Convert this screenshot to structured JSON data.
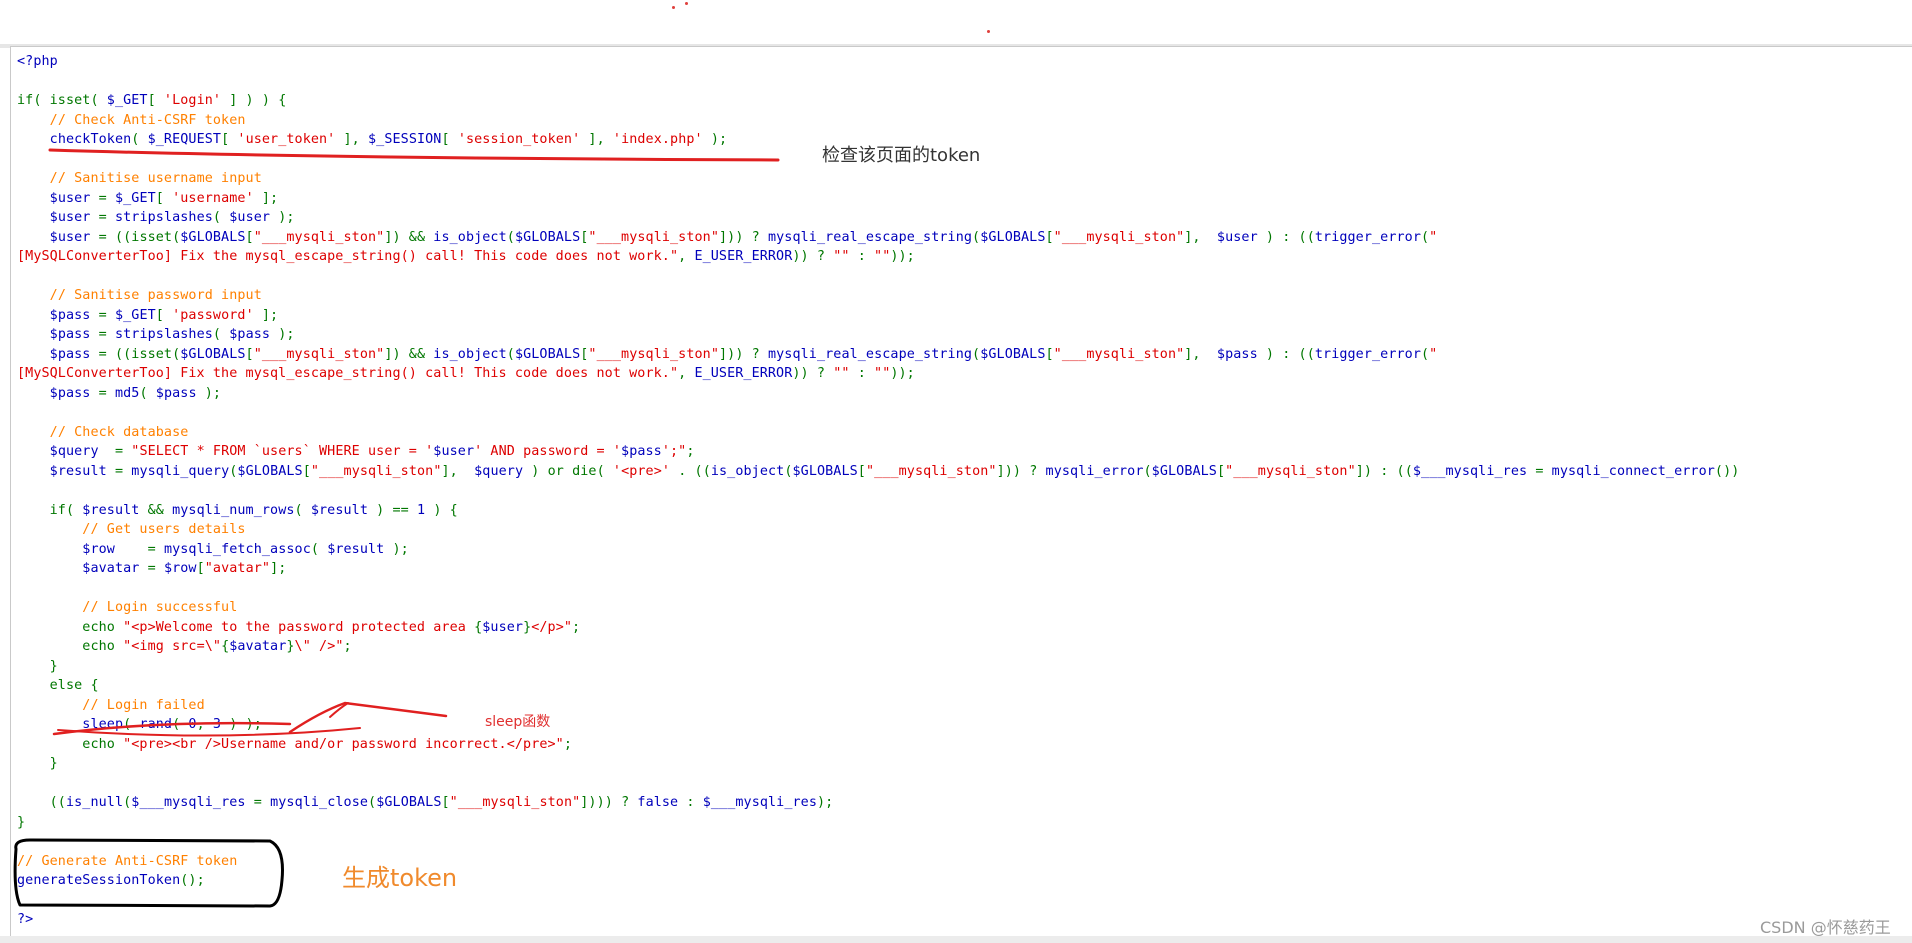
{
  "code": {
    "lines": [
      [
        [
          "php",
          "<?php"
        ]
      ],
      [],
      [
        [
          "kw",
          "if( isset( "
        ],
        [
          "php",
          "$_GET"
        ],
        [
          "kw",
          "[ "
        ],
        [
          "str",
          "'Login'"
        ],
        [
          "kw",
          " ] ) ) {"
        ]
      ],
      [
        [
          "kw",
          "    "
        ],
        [
          "cmt",
          "// Check Anti-CSRF token"
        ]
      ],
      [
        [
          "kw",
          "    "
        ],
        [
          "php",
          "checkToken"
        ],
        [
          "kw",
          "( "
        ],
        [
          "php",
          "$_REQUEST"
        ],
        [
          "kw",
          "[ "
        ],
        [
          "str",
          "'user_token'"
        ],
        [
          "kw",
          " ], "
        ],
        [
          "php",
          "$_SESSION"
        ],
        [
          "kw",
          "[ "
        ],
        [
          "str",
          "'session_token'"
        ],
        [
          "kw",
          " ], "
        ],
        [
          "str",
          "'index.php'"
        ],
        [
          "kw",
          " );"
        ]
      ],
      [],
      [
        [
          "kw",
          "    "
        ],
        [
          "cmt",
          "// Sanitise username input"
        ]
      ],
      [
        [
          "kw",
          "    "
        ],
        [
          "php",
          "$user"
        ],
        [
          "kw",
          " = "
        ],
        [
          "php",
          "$_GET"
        ],
        [
          "kw",
          "[ "
        ],
        [
          "str",
          "'username'"
        ],
        [
          "kw",
          " ];"
        ]
      ],
      [
        [
          "kw",
          "    "
        ],
        [
          "php",
          "$user"
        ],
        [
          "kw",
          " = "
        ],
        [
          "php",
          "stripslashes"
        ],
        [
          "kw",
          "( "
        ],
        [
          "php",
          "$user"
        ],
        [
          "kw",
          " );"
        ]
      ],
      [
        [
          "kw",
          "    "
        ],
        [
          "php",
          "$user"
        ],
        [
          "kw",
          " = ((isset("
        ],
        [
          "php",
          "$GLOBALS"
        ],
        [
          "kw",
          "["
        ],
        [
          "str",
          "\"___mysqli_ston\""
        ],
        [
          "kw",
          "]) && "
        ],
        [
          "php",
          "is_object"
        ],
        [
          "kw",
          "("
        ],
        [
          "php",
          "$GLOBALS"
        ],
        [
          "kw",
          "["
        ],
        [
          "str",
          "\"___mysqli_ston\""
        ],
        [
          "kw",
          "])) ? "
        ],
        [
          "php",
          "mysqli_real_escape_string"
        ],
        [
          "kw",
          "("
        ],
        [
          "php",
          "$GLOBALS"
        ],
        [
          "kw",
          "["
        ],
        [
          "str",
          "\"___mysqli_ston\""
        ],
        [
          "kw",
          "],  "
        ],
        [
          "php",
          "$user"
        ],
        [
          "kw",
          " ) : (("
        ],
        [
          "php",
          "trigger_error"
        ],
        [
          "kw",
          "("
        ],
        [
          "str",
          "\""
        ]
      ],
      [
        [
          "str",
          "[MySQLConverterToo] Fix the mysql_escape_string() call! This code does not work.\""
        ],
        [
          "kw",
          ", "
        ],
        [
          "php",
          "E_USER_ERROR"
        ],
        [
          "kw",
          ")) ? "
        ],
        [
          "str",
          "\"\""
        ],
        [
          "kw",
          " : "
        ],
        [
          "str",
          "\"\""
        ],
        [
          "kw",
          "));"
        ]
      ],
      [],
      [
        [
          "kw",
          "    "
        ],
        [
          "cmt",
          "// Sanitise password input"
        ]
      ],
      [
        [
          "kw",
          "    "
        ],
        [
          "php",
          "$pass"
        ],
        [
          "kw",
          " = "
        ],
        [
          "php",
          "$_GET"
        ],
        [
          "kw",
          "[ "
        ],
        [
          "str",
          "'password'"
        ],
        [
          "kw",
          " ];"
        ]
      ],
      [
        [
          "kw",
          "    "
        ],
        [
          "php",
          "$pass"
        ],
        [
          "kw",
          " = "
        ],
        [
          "php",
          "stripslashes"
        ],
        [
          "kw",
          "( "
        ],
        [
          "php",
          "$pass"
        ],
        [
          "kw",
          " );"
        ]
      ],
      [
        [
          "kw",
          "    "
        ],
        [
          "php",
          "$pass"
        ],
        [
          "kw",
          " = ((isset("
        ],
        [
          "php",
          "$GLOBALS"
        ],
        [
          "kw",
          "["
        ],
        [
          "str",
          "\"___mysqli_ston\""
        ],
        [
          "kw",
          "]) && "
        ],
        [
          "php",
          "is_object"
        ],
        [
          "kw",
          "("
        ],
        [
          "php",
          "$GLOBALS"
        ],
        [
          "kw",
          "["
        ],
        [
          "str",
          "\"___mysqli_ston\""
        ],
        [
          "kw",
          "])) ? "
        ],
        [
          "php",
          "mysqli_real_escape_string"
        ],
        [
          "kw",
          "("
        ],
        [
          "php",
          "$GLOBALS"
        ],
        [
          "kw",
          "["
        ],
        [
          "str",
          "\"___mysqli_ston\""
        ],
        [
          "kw",
          "],  "
        ],
        [
          "php",
          "$pass"
        ],
        [
          "kw",
          " ) : (("
        ],
        [
          "php",
          "trigger_error"
        ],
        [
          "kw",
          "("
        ],
        [
          "str",
          "\""
        ]
      ],
      [
        [
          "str",
          "[MySQLConverterToo] Fix the mysql_escape_string() call! This code does not work.\""
        ],
        [
          "kw",
          ", "
        ],
        [
          "php",
          "E_USER_ERROR"
        ],
        [
          "kw",
          ")) ? "
        ],
        [
          "str",
          "\"\""
        ],
        [
          "kw",
          " : "
        ],
        [
          "str",
          "\"\""
        ],
        [
          "kw",
          "));"
        ]
      ],
      [
        [
          "kw",
          "    "
        ],
        [
          "php",
          "$pass"
        ],
        [
          "kw",
          " = "
        ],
        [
          "php",
          "md5"
        ],
        [
          "kw",
          "( "
        ],
        [
          "php",
          "$pass"
        ],
        [
          "kw",
          " );"
        ]
      ],
      [],
      [
        [
          "kw",
          "    "
        ],
        [
          "cmt",
          "// Check database"
        ]
      ],
      [
        [
          "kw",
          "    "
        ],
        [
          "php",
          "$query"
        ],
        [
          "kw",
          "  = "
        ],
        [
          "str",
          "\"SELECT * FROM `users` WHERE user = '"
        ],
        [
          "php",
          "$user"
        ],
        [
          "str",
          "' AND password = '"
        ],
        [
          "php",
          "$pass"
        ],
        [
          "str",
          "';\""
        ],
        [
          "kw",
          ";"
        ]
      ],
      [
        [
          "kw",
          "    "
        ],
        [
          "php",
          "$result"
        ],
        [
          "kw",
          " = "
        ],
        [
          "php",
          "mysqli_query"
        ],
        [
          "kw",
          "("
        ],
        [
          "php",
          "$GLOBALS"
        ],
        [
          "kw",
          "["
        ],
        [
          "str",
          "\"___mysqli_ston\""
        ],
        [
          "kw",
          "],  "
        ],
        [
          "php",
          "$query"
        ],
        [
          "kw",
          " ) or die( "
        ],
        [
          "str",
          "'<pre>'"
        ],
        [
          "kw",
          " . (("
        ],
        [
          "php",
          "is_object"
        ],
        [
          "kw",
          "("
        ],
        [
          "php",
          "$GLOBALS"
        ],
        [
          "kw",
          "["
        ],
        [
          "str",
          "\"___mysqli_ston\""
        ],
        [
          "kw",
          "])) ? "
        ],
        [
          "php",
          "mysqli_error"
        ],
        [
          "kw",
          "("
        ],
        [
          "php",
          "$GLOBALS"
        ],
        [
          "kw",
          "["
        ],
        [
          "str",
          "\"___mysqli_ston\""
        ],
        [
          "kw",
          "]) : (("
        ],
        [
          "php",
          "$___mysqli_res"
        ],
        [
          "kw",
          " = "
        ],
        [
          "php",
          "mysqli_connect_error"
        ],
        [
          "kw",
          "())"
        ]
      ],
      [],
      [
        [
          "kw",
          "    if( "
        ],
        [
          "php",
          "$result"
        ],
        [
          "kw",
          " && "
        ],
        [
          "php",
          "mysqli_num_rows"
        ],
        [
          "kw",
          "( "
        ],
        [
          "php",
          "$result"
        ],
        [
          "kw",
          " ) == "
        ],
        [
          "php",
          "1"
        ],
        [
          "kw",
          " ) {"
        ]
      ],
      [
        [
          "kw",
          "        "
        ],
        [
          "cmt",
          "// Get users details"
        ]
      ],
      [
        [
          "kw",
          "        "
        ],
        [
          "php",
          "$row"
        ],
        [
          "kw",
          "    = "
        ],
        [
          "php",
          "mysqli_fetch_assoc"
        ],
        [
          "kw",
          "( "
        ],
        [
          "php",
          "$result"
        ],
        [
          "kw",
          " );"
        ]
      ],
      [
        [
          "kw",
          "        "
        ],
        [
          "php",
          "$avatar"
        ],
        [
          "kw",
          " = "
        ],
        [
          "php",
          "$row"
        ],
        [
          "kw",
          "["
        ],
        [
          "str",
          "\"avatar\""
        ],
        [
          "kw",
          "];"
        ]
      ],
      [],
      [
        [
          "kw",
          "        "
        ],
        [
          "cmt",
          "// Login successful"
        ]
      ],
      [
        [
          "kw",
          "        echo "
        ],
        [
          "str",
          "\"<p>Welcome to the password protected area "
        ],
        [
          "kw",
          "{"
        ],
        [
          "php",
          "$user"
        ],
        [
          "kw",
          "}"
        ],
        [
          "str",
          "</p>\""
        ],
        [
          "kw",
          ";"
        ]
      ],
      [
        [
          "kw",
          "        echo "
        ],
        [
          "str",
          "\"<img src=\\\""
        ],
        [
          "kw",
          "{"
        ],
        [
          "php",
          "$avatar"
        ],
        [
          "kw",
          "}"
        ],
        [
          "str",
          "\\\" />\""
        ],
        [
          "kw",
          ";"
        ]
      ],
      [
        [
          "kw",
          "    }"
        ]
      ],
      [
        [
          "kw",
          "    else {"
        ]
      ],
      [
        [
          "kw",
          "        "
        ],
        [
          "cmt",
          "// Login failed"
        ]
      ],
      [
        [
          "kw",
          "        "
        ],
        [
          "php",
          "sleep"
        ],
        [
          "kw",
          "( "
        ],
        [
          "php",
          "rand"
        ],
        [
          "kw",
          "( "
        ],
        [
          "php",
          "0"
        ],
        [
          "kw",
          ", "
        ],
        [
          "php",
          "3"
        ],
        [
          "kw",
          " ) );"
        ]
      ],
      [
        [
          "kw",
          "        echo "
        ],
        [
          "str",
          "\"<pre><br />Username and/or password incorrect.</pre>\""
        ],
        [
          "kw",
          ";"
        ]
      ],
      [
        [
          "kw",
          "    }"
        ]
      ],
      [],
      [
        [
          "kw",
          "    (("
        ],
        [
          "php",
          "is_null"
        ],
        [
          "kw",
          "("
        ],
        [
          "php",
          "$___mysqli_res"
        ],
        [
          "kw",
          " = "
        ],
        [
          "php",
          "mysqli_close"
        ],
        [
          "kw",
          "("
        ],
        [
          "php",
          "$GLOBALS"
        ],
        [
          "kw",
          "["
        ],
        [
          "str",
          "\"___mysqli_ston\""
        ],
        [
          "kw",
          "]))) ? "
        ],
        [
          "php",
          "false"
        ],
        [
          "kw",
          " : "
        ],
        [
          "php",
          "$___mysqli_res"
        ],
        [
          "kw",
          ");"
        ]
      ],
      [
        [
          "kw",
          "}"
        ]
      ],
      [],
      [
        [
          "cmt",
          "// Generate Anti-CSRF token"
        ]
      ],
      [
        [
          "php",
          "generateSessionToken"
        ],
        [
          "kw",
          "();"
        ]
      ],
      [],
      [
        [
          "php",
          "?>"
        ]
      ]
    ]
  },
  "annotations": {
    "check_token": "检查该页面的token",
    "sleep_func": "sleep函数",
    "generate_token": "生成token"
  },
  "watermark": "CSDN @怀慈药王",
  "colors": {
    "keyword": "#007700",
    "identifier": "#0000bb",
    "comment": "#ff8000",
    "string": "#dd0000",
    "markup_red": "#e02020",
    "markup_black": "#000000",
    "annotation_orange": "#f08a2c"
  }
}
